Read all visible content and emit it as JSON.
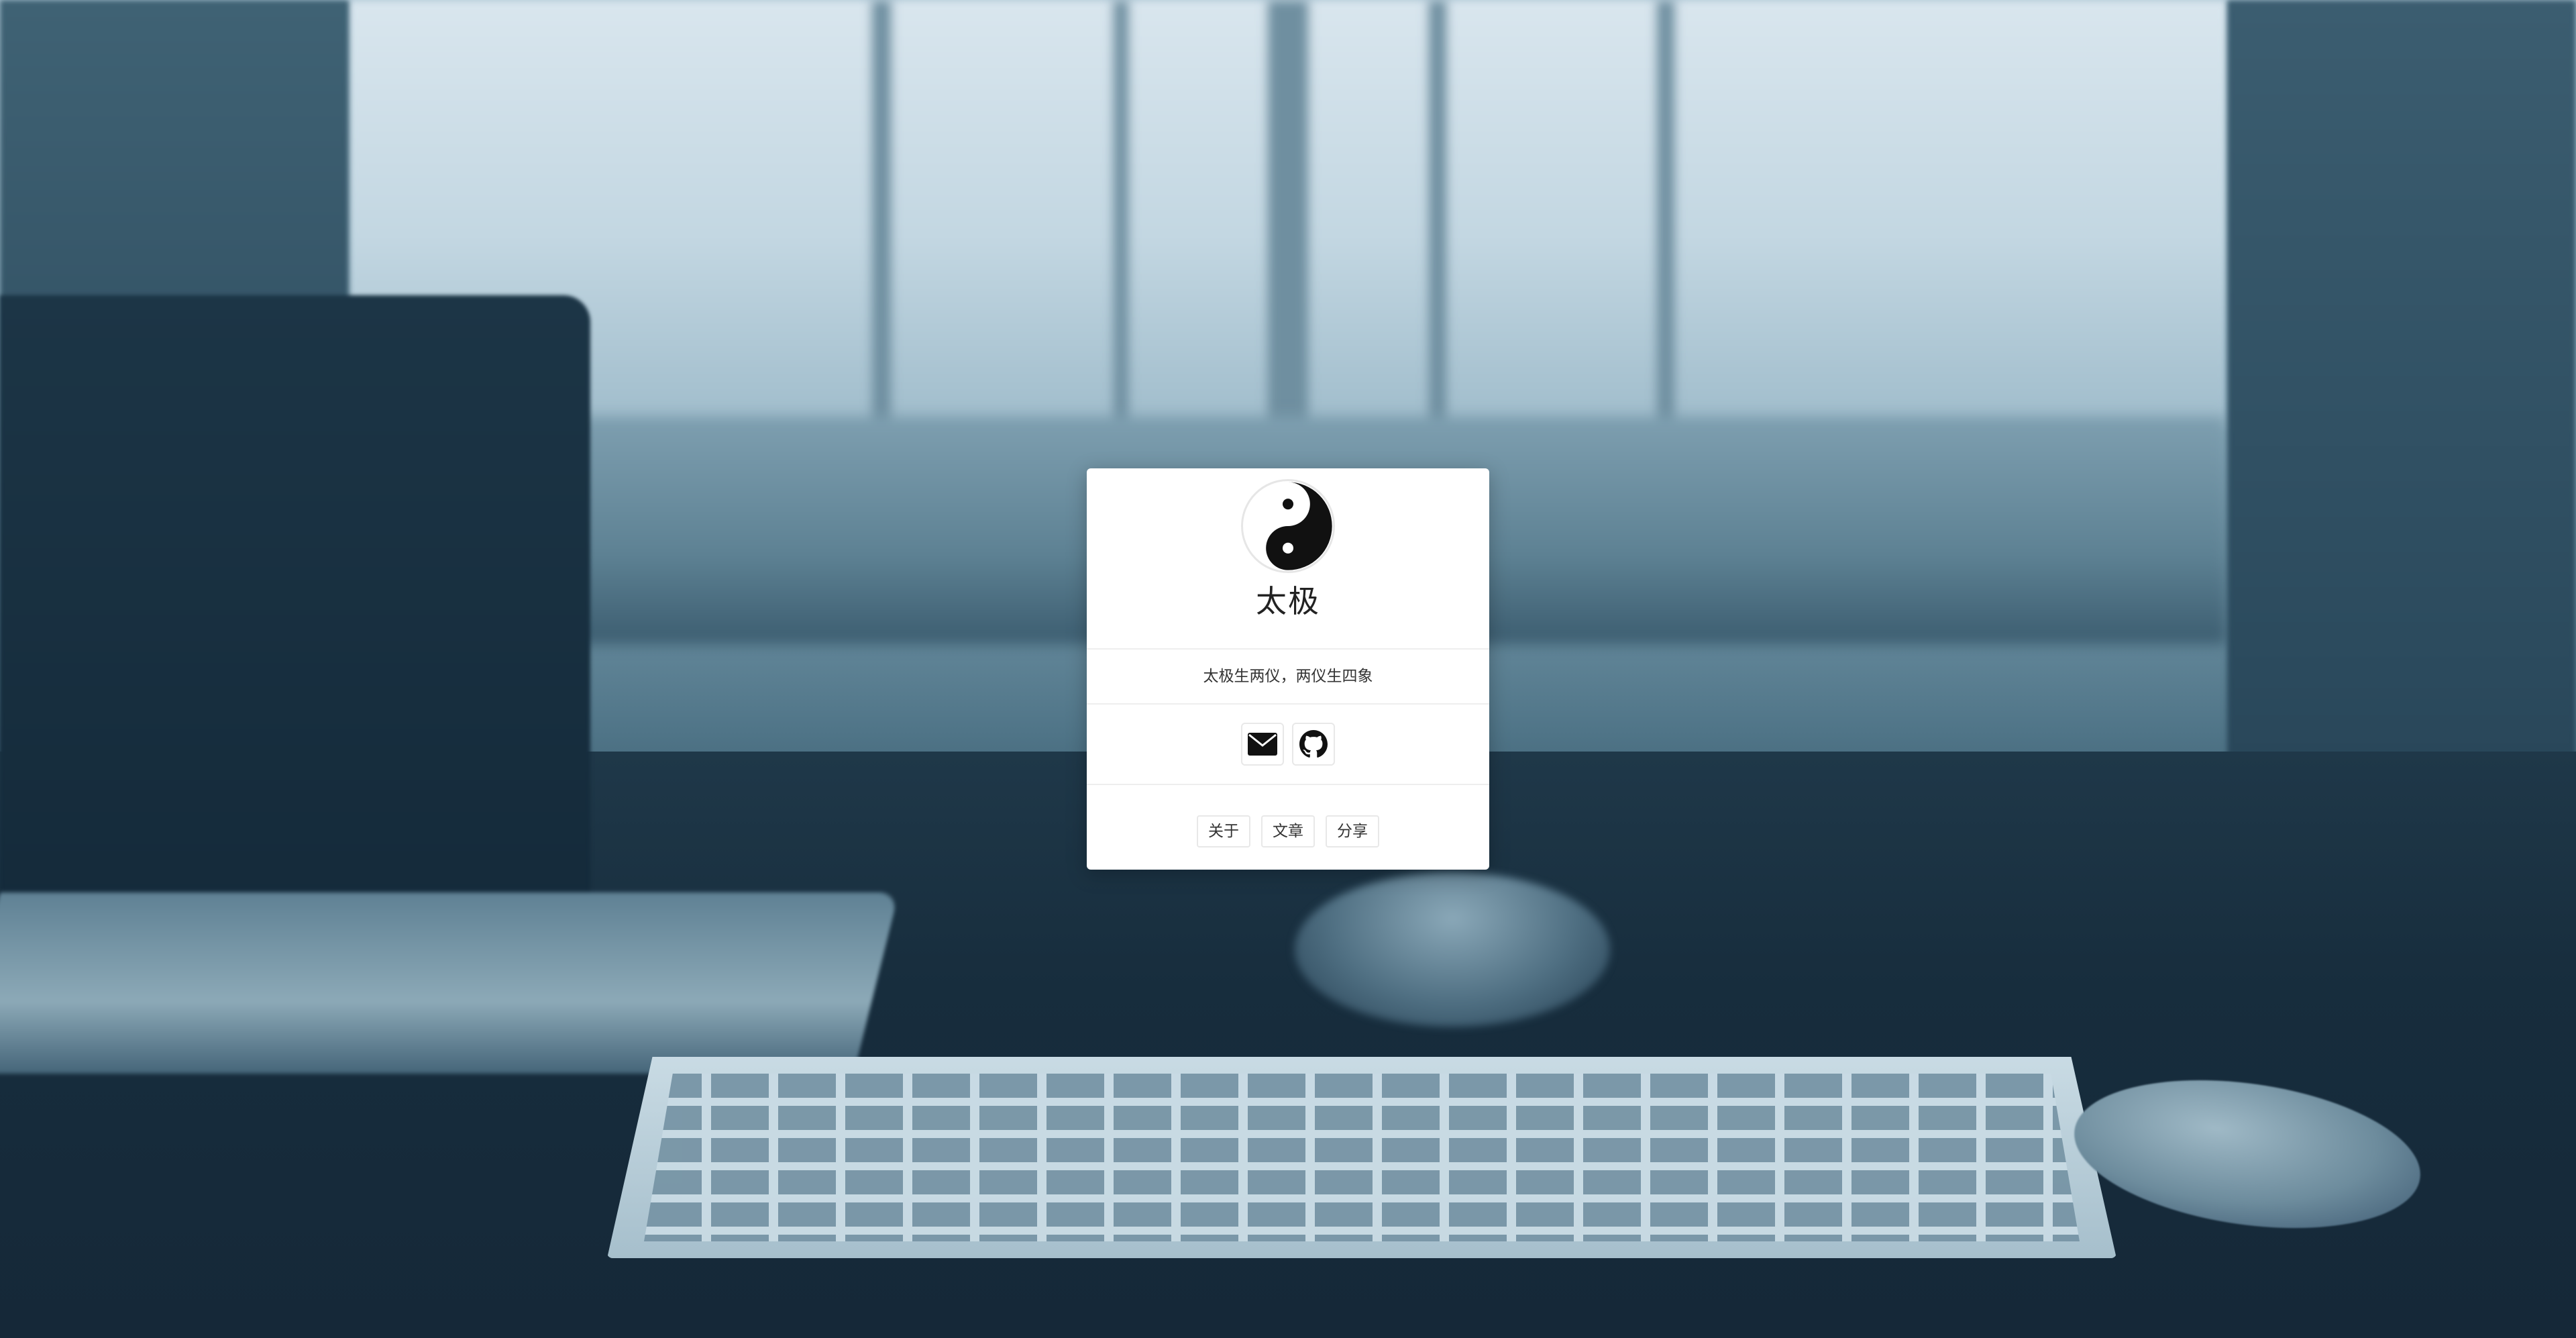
{
  "profile": {
    "name": "太极",
    "motto": "太极生两仪，两仪生四象",
    "avatar_icon": "yin-yang-icon"
  },
  "social": [
    {
      "icon": "envelope-icon",
      "label": "Email"
    },
    {
      "icon": "github-icon",
      "label": "GitHub"
    }
  ],
  "nav": {
    "about": "关于",
    "articles": "文章",
    "share": "分享"
  },
  "colors": {
    "card_background": "#ffffff",
    "divider": "#eeeeee",
    "text": "#333333",
    "background_tint": "#1e3547"
  }
}
